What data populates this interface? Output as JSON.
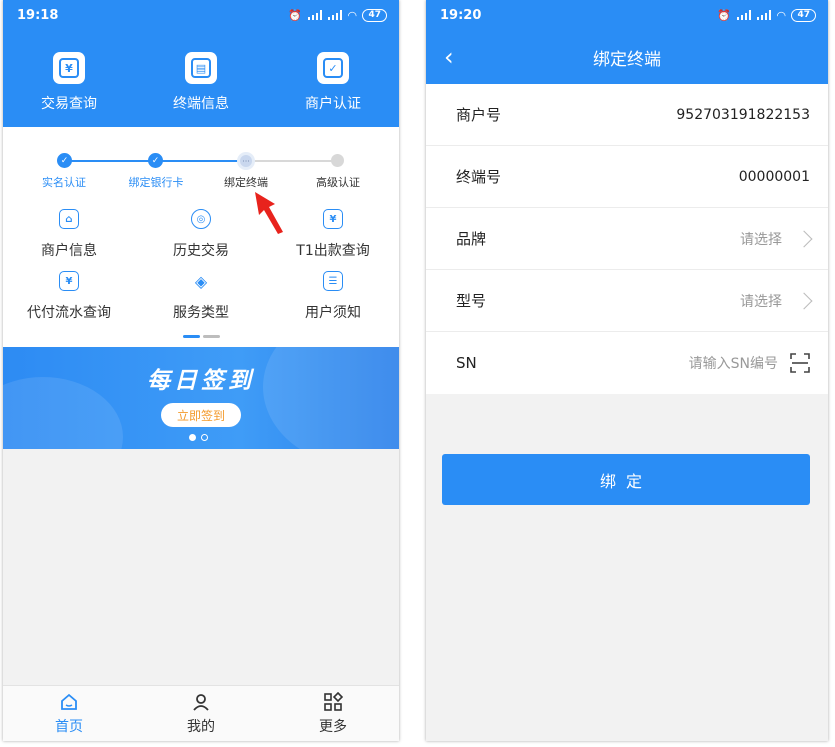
{
  "left": {
    "status": {
      "time": "19:18",
      "battery": "47"
    },
    "top_items": [
      {
        "label": "交易查询",
        "glyph": "¥"
      },
      {
        "label": "终端信息",
        "glyph": "▤"
      },
      {
        "label": "商户认证",
        "glyph": "✓"
      }
    ],
    "steps": [
      {
        "label": "实名认证",
        "state": "done"
      },
      {
        "label": "绑定银行卡",
        "state": "done"
      },
      {
        "label": "绑定终端",
        "state": "current"
      },
      {
        "label": "高级认证",
        "state": "todo"
      }
    ],
    "grid": [
      {
        "label": "商户信息",
        "glyph": "⌂"
      },
      {
        "label": "历史交易",
        "glyph": "◎"
      },
      {
        "label": "T1出款查询",
        "glyph": "¥"
      },
      {
        "label": "代付流水查询",
        "glyph": "¥"
      },
      {
        "label": "服务类型",
        "glyph": "◈"
      },
      {
        "label": "用户须知",
        "glyph": "☰"
      }
    ],
    "banner": {
      "title": "每日签到",
      "button": "立即签到"
    },
    "tabs": [
      {
        "label": "首页",
        "active": true
      },
      {
        "label": "我的",
        "active": false
      },
      {
        "label": "更多",
        "active": false
      }
    ]
  },
  "right": {
    "status": {
      "time": "19:20",
      "battery": "47"
    },
    "title": "绑定终端",
    "fields": {
      "merchant_no": {
        "label": "商户号",
        "value": "952703191822153"
      },
      "terminal_no": {
        "label": "终端号",
        "value": "00000001"
      },
      "brand": {
        "label": "品牌",
        "placeholder": "请选择"
      },
      "model": {
        "label": "型号",
        "placeholder": "请选择"
      },
      "sn": {
        "label": "SN",
        "placeholder": "请输入SN编号"
      }
    },
    "bind_button": "绑定"
  },
  "colors": {
    "primary": "#2a8df5",
    "accent_orange": "#f39a2b",
    "arrow_red": "#e8231d"
  }
}
